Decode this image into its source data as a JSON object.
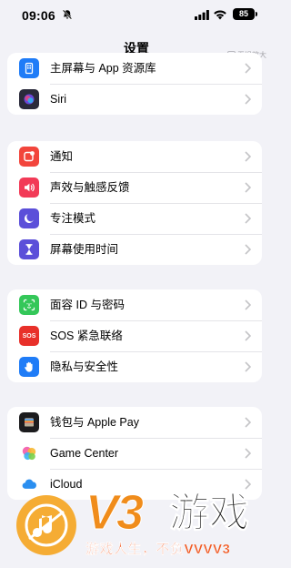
{
  "status": {
    "time": "09:06",
    "battery": "85"
  },
  "nav": {
    "title": "设置",
    "badge": "无损放大"
  },
  "colors": {
    "background": "#f2f2f7",
    "home_screen": "#1f7cf7",
    "siri": "#2a2a3a",
    "notifications": "#f2453c",
    "sounds": "#f23a57",
    "focus": "#5b4fd9",
    "screen_time": "#5b4fd9",
    "face_id": "#34c759",
    "sos": "#e8302a",
    "privacy": "#1f7cf7",
    "wallet": "#1c1c1e",
    "game_center": "#ffffff",
    "icloud": "#ffffff",
    "watermark_orange": "#f08c1b"
  },
  "groups": [
    {
      "items": [
        {
          "label": "主屏幕与 App 资源库",
          "icon": "home-screen-icon"
        },
        {
          "label": "Siri",
          "icon": "siri-icon"
        }
      ]
    },
    {
      "items": [
        {
          "label": "通知",
          "icon": "notifications-icon"
        },
        {
          "label": "声效与触感反馈",
          "icon": "speaker-icon"
        },
        {
          "label": "专注模式",
          "icon": "moon-icon"
        },
        {
          "label": "屏幕使用时间",
          "icon": "hourglass-icon"
        }
      ]
    },
    {
      "items": [
        {
          "label": "面容 ID 与密码",
          "icon": "face-id-icon"
        },
        {
          "label": "SOS 紧急联络",
          "icon": "sos-icon",
          "icon_text": "SOS"
        },
        {
          "label": "隐私与安全性",
          "icon": "hand-icon"
        }
      ]
    },
    {
      "items": [
        {
          "label": "钱包与 Apple Pay",
          "icon": "wallet-icon"
        },
        {
          "label": "Game Center",
          "icon": "game-center-icon"
        },
        {
          "label": "iCloud",
          "icon": "icloud-icon"
        }
      ]
    }
  ],
  "watermark": {
    "brand": "V3",
    "word": "游戏",
    "slogan": "游戏人生，不负VVVV3"
  }
}
